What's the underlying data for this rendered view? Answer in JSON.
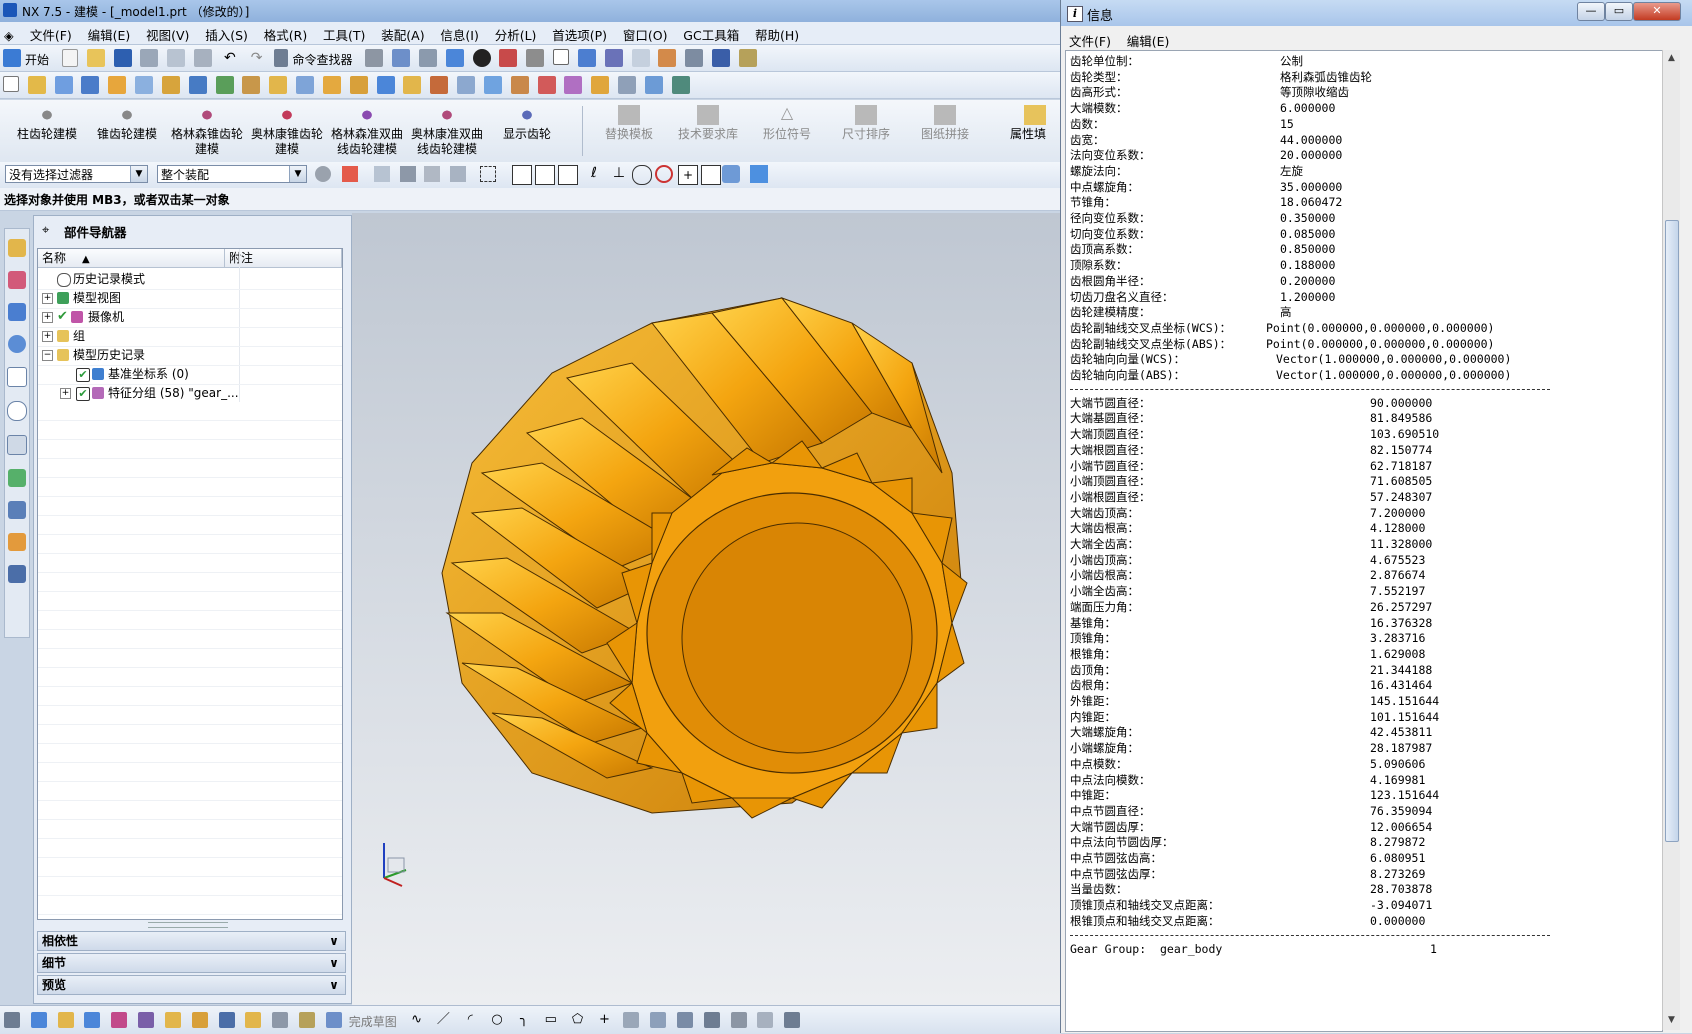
{
  "app": {
    "title": "NX 7.5 - 建模 - [_model1.prt （修改的）]",
    "menus": [
      "文件(F)",
      "编辑(E)",
      "视图(V)",
      "插入(S)",
      "格式(R)",
      "工具(T)",
      "装配(A)",
      "信息(I)",
      "分析(L)",
      "首选项(P)",
      "窗口(O)",
      "GC工具箱",
      "帮助(H)"
    ]
  },
  "toolbar": {
    "start_label": "开始",
    "command_finder_label": "命令查找器"
  },
  "gear_toolbar": {
    "buttons": [
      {
        "label": "柱齿轮建模",
        "enabled": true
      },
      {
        "label": "锥齿轮建模",
        "enabled": true
      },
      {
        "label": "格林森锥齿轮建模",
        "enabled": true
      },
      {
        "label": "奥林康锥齿轮建模",
        "enabled": true
      },
      {
        "label": "格林森准双曲线齿轮建模",
        "enabled": true
      },
      {
        "label": "奥林康准双曲线齿轮建模",
        "enabled": true
      },
      {
        "label": "显示齿轮",
        "enabled": true
      },
      {
        "label": "替换模板",
        "enabled": false
      },
      {
        "label": "技术要求库",
        "enabled": false
      },
      {
        "label": "形位符号",
        "enabled": false
      },
      {
        "label": "尺寸排序",
        "enabled": false
      },
      {
        "label": "图纸拼接",
        "enabled": false
      },
      {
        "label": "属性填",
        "enabled": true
      }
    ]
  },
  "selection": {
    "filter_value": "没有选择过滤器",
    "scope_value": "整个装配"
  },
  "cue_line": "选择对象并使用 MB3，或者双击某一对象",
  "navigator": {
    "title": "部件导航器",
    "col_name": "名称",
    "col_note": "附注",
    "rows": [
      {
        "label": "历史记录模式"
      },
      {
        "label": "模型视图"
      },
      {
        "label": "摄像机"
      },
      {
        "label": "组"
      },
      {
        "label": "模型历史记录"
      },
      {
        "label": "基准坐标系 (0)"
      },
      {
        "label": "特征分组 (58) \"gear_..."
      }
    ],
    "panels": [
      "相依性",
      "细节",
      "预览"
    ]
  },
  "bottom_toolbar": {
    "finish_sketch_label": "完成草图"
  },
  "info_window": {
    "title": "信息",
    "menus": [
      "文件(F)",
      "编辑(E)"
    ],
    "params": [
      {
        "k": "齿轮单位制：",
        "v": "公制"
      },
      {
        "k": "齿轮类型：",
        "v": "格利森弧齿锥齿轮"
      },
      {
        "k": "齿高形式：",
        "v": "等顶隙收缩齿"
      },
      {
        "k": "大端模数：",
        "v": "6.000000"
      },
      {
        "k": "齿数：",
        "v": "15"
      },
      {
        "k": "齿宽：",
        "v": "44.000000"
      },
      {
        "k": "法向变位系数：",
        "v": "20.000000"
      },
      {
        "k": "螺旋法向：",
        "v": "左旋"
      },
      {
        "k": "中点螺旋角：",
        "v": "35.000000"
      },
      {
        "k": "节锥角：",
        "v": "18.060472"
      },
      {
        "k": "径向变位系数：",
        "v": "0.350000"
      },
      {
        "k": "切向变位系数：",
        "v": "0.085000"
      },
      {
        "k": "齿顶高系数：",
        "v": "0.850000"
      },
      {
        "k": "顶隙系数：",
        "v": "0.188000"
      },
      {
        "k": "齿根圆角半径：",
        "v": "0.200000"
      },
      {
        "k": "切齿刀盘名义直径：",
        "v": "1.200000"
      },
      {
        "k": "齿轮建模精度：",
        "v": "高"
      },
      {
        "k": "齿轮副轴线交叉点坐标(WCS)：",
        "v": "Point(0.000000,0.000000,0.000000)"
      },
      {
        "k": "齿轮副轴线交叉点坐标(ABS)：",
        "v": "Point(0.000000,0.000000,0.000000)"
      },
      {
        "k": "齿轮轴向向量(WCS)：",
        "v": "Vector(1.000000,0.000000,0.000000)"
      },
      {
        "k": "齿轮轴向向量(ABS)：",
        "v": "Vector(1.000000,0.000000,0.000000)"
      }
    ],
    "results": [
      {
        "k": "大端节圆直径：",
        "v": "90.000000"
      },
      {
        "k": "大端基圆直径：",
        "v": "81.849586"
      },
      {
        "k": "大端顶圆直径：",
        "v": "103.690510"
      },
      {
        "k": "大端根圆直径：",
        "v": "82.150774"
      },
      {
        "k": "小端节圆直径：",
        "v": "62.718187"
      },
      {
        "k": "小端顶圆直径：",
        "v": "71.608505"
      },
      {
        "k": "小端根圆直径：",
        "v": "57.248307"
      },
      {
        "k": "大端齿顶高：",
        "v": "7.200000"
      },
      {
        "k": "大端齿根高：",
        "v": "4.128000"
      },
      {
        "k": "大端全齿高：",
        "v": "11.328000"
      },
      {
        "k": "小端齿顶高：",
        "v": "4.675523"
      },
      {
        "k": "小端齿根高：",
        "v": "2.876674"
      },
      {
        "k": "小端全齿高：",
        "v": "7.552197"
      },
      {
        "k": "端面压力角：",
        "v": "26.257297"
      },
      {
        "k": "基锥角：",
        "v": "16.376328"
      },
      {
        "k": "顶锥角：",
        "v": "3.283716"
      },
      {
        "k": "根锥角：",
        "v": "1.629008"
      },
      {
        "k": "齿顶角：",
        "v": "21.344188"
      },
      {
        "k": "齿根角：",
        "v": "16.431464"
      },
      {
        "k": "外锥距：",
        "v": "145.151644"
      },
      {
        "k": "内锥距：",
        "v": "101.151644"
      },
      {
        "k": "大端螺旋角：",
        "v": "42.453811"
      },
      {
        "k": "小端螺旋角：",
        "v": "28.187987"
      },
      {
        "k": "中点模数：",
        "v": "5.090606"
      },
      {
        "k": "中点法向模数：",
        "v": "4.169981"
      },
      {
        "k": "中锥距：",
        "v": "123.151644"
      },
      {
        "k": "中点节圆直径：",
        "v": "76.359094"
      },
      {
        "k": "大端节圆齿厚：",
        "v": "12.006654"
      },
      {
        "k": "中点法向节圆齿厚：",
        "v": "8.279872"
      },
      {
        "k": "中点节圆弦齿高：",
        "v": "6.080951"
      },
      {
        "k": "中点节圆弦齿厚：",
        "v": "8.273269"
      },
      {
        "k": "当量齿数：",
        "v": "28.703878"
      },
      {
        "k": "顶锥顶点和轴线交叉点距离：",
        "v": "-3.094071"
      },
      {
        "k": "根锥顶点和轴线交叉点距离：",
        "v": "0.000000"
      }
    ],
    "footer_line": "Gear Group:  gear_body                              1"
  }
}
